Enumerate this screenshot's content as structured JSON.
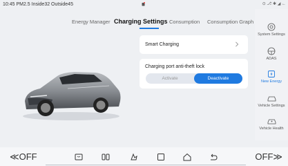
{
  "status": {
    "left_text": "10:45 PM2.5 Inside32 Outside45",
    "right_text": "⊙ ⎇ ✱ ◢ ←"
  },
  "tabs": {
    "energy_manager": "Energy Manager",
    "charging_settings": "Charging Settings",
    "consumption": "Consumption",
    "consumption_graph": "Consumption Graph"
  },
  "sidebar": {
    "items": [
      {
        "label": "System Settings",
        "icon": "settings-icon"
      },
      {
        "label": "ADAS",
        "icon": "steering-wheel-icon"
      },
      {
        "label": "New Energy",
        "icon": "battery-energy-icon",
        "active": true
      },
      {
        "label": "Vehicle Settings",
        "icon": "car-icon"
      },
      {
        "label": "Vehicle Health",
        "icon": "car-health-icon"
      }
    ]
  },
  "main": {
    "smart_charging": "Smart Charging",
    "antitheft_title": "Charging port anti-theft lock",
    "activate": "Activate",
    "deactivate": "Deactivate",
    "selected": "Deactivate"
  },
  "bottom": {
    "left_temp": "OFF",
    "right_temp": "OFF",
    "icons": [
      "seat-heat-icon",
      "rear-defrost-icon",
      "fan-icon",
      "square-icon",
      "home-icon",
      "back-icon"
    ]
  },
  "colors": {
    "accent": "#1f7ae0",
    "background": "#eef0f3",
    "card": "#ffffff"
  }
}
